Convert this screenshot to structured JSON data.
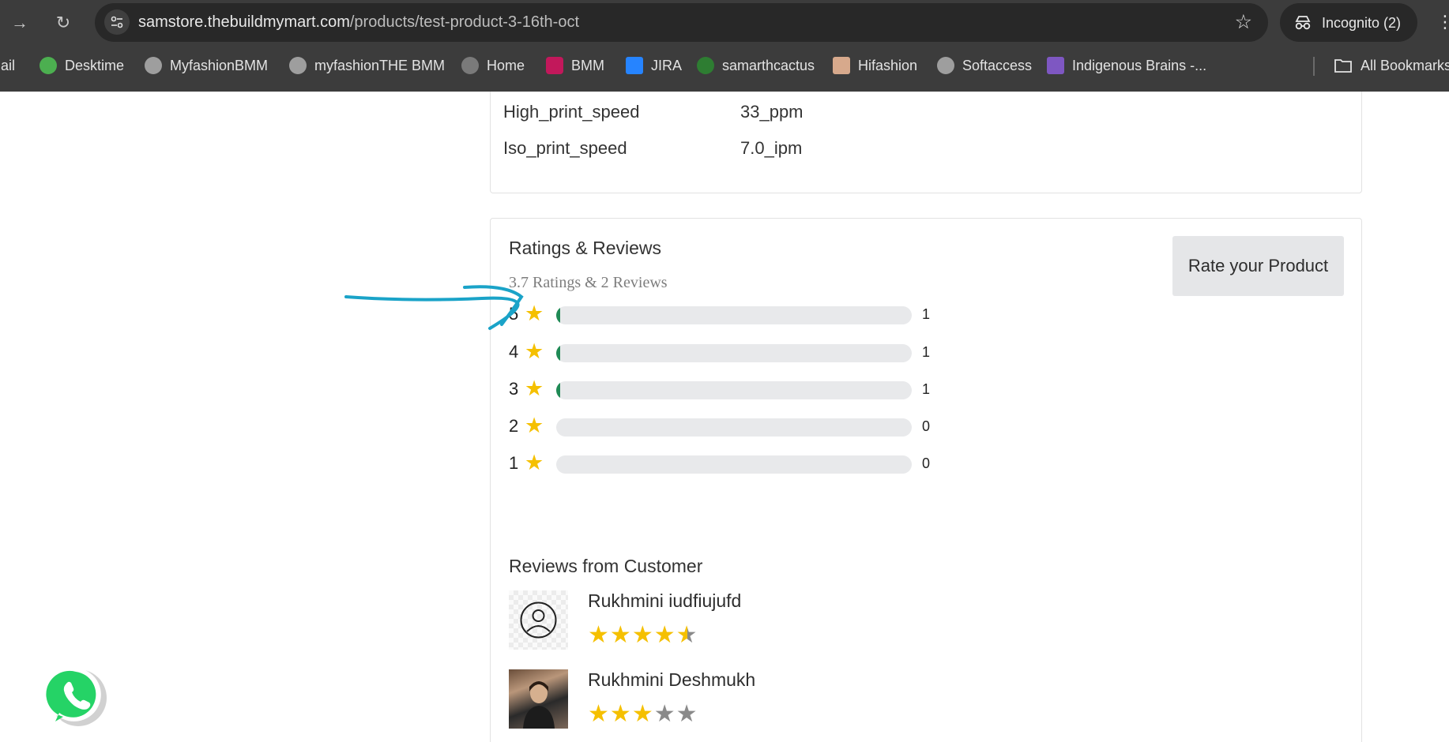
{
  "browser": {
    "url_host": "samstore.thebuildmymart.com",
    "url_path": "/products/test-product-3-16th-oct",
    "incognito_label": "Incognito (2)",
    "bookmarks": [
      {
        "label": "Mail",
        "icon": "mail-icon",
        "color": "#ea4335"
      },
      {
        "label": "Desktime",
        "icon": "desktime-icon",
        "color": "#4caf50"
      },
      {
        "label": "MyfashionBMM",
        "icon": "globe-icon",
        "color": "#9e9e9e"
      },
      {
        "label": "myfashionTHE BMM",
        "icon": "globe-icon",
        "color": "#9e9e9e"
      },
      {
        "label": "Home",
        "icon": "globe-icon",
        "color": "#7a7a7a"
      },
      {
        "label": "BMM",
        "icon": "bmm-icon",
        "color": "#c2185b"
      },
      {
        "label": "JIRA",
        "icon": "jira-icon",
        "color": "#2684ff"
      },
      {
        "label": "samarthcactus",
        "icon": "cactus-icon",
        "color": "#2e7d32"
      },
      {
        "label": "Hifashion",
        "icon": "hifashion-icon",
        "color": "#d7a98c"
      },
      {
        "label": "Softaccess",
        "icon": "globe-icon",
        "color": "#9e9e9e"
      },
      {
        "label": "Indigenous Brains -...",
        "icon": "indigenous-icon",
        "color": "#7e57c2"
      }
    ],
    "all_bookmarks_label": "All Bookmarks"
  },
  "specs": [
    {
      "key": "High_print_speed",
      "value": "33_ppm"
    },
    {
      "key": "Iso_print_speed",
      "value": "7.0_ipm"
    }
  ],
  "ratings": {
    "title": "Ratings & Reviews",
    "summary": "3.7 Ratings & 2 Reviews",
    "rate_button": "Rate your Product",
    "rows": [
      {
        "star": "5",
        "count": "1",
        "fraction": 0.01
      },
      {
        "star": "4",
        "count": "1",
        "fraction": 0.01
      },
      {
        "star": "3",
        "count": "1",
        "fraction": 0.01
      },
      {
        "star": "2",
        "count": "0",
        "fraction": 0
      },
      {
        "star": "1",
        "count": "0",
        "fraction": 0
      }
    ]
  },
  "reviews": {
    "title": "Reviews from Customer",
    "items": [
      {
        "name": "Rukhmini iudfiujufd",
        "rating": 4.5,
        "avatar": "placeholder-avatar"
      },
      {
        "name": "Rukhmini Deshmukh",
        "rating": 3,
        "avatar": "photo-avatar"
      }
    ]
  },
  "colors": {
    "star": "#f5c000",
    "bar_fill": "#1f8a55",
    "annotation": "#1aa3c8",
    "whatsapp": "#25d366"
  }
}
